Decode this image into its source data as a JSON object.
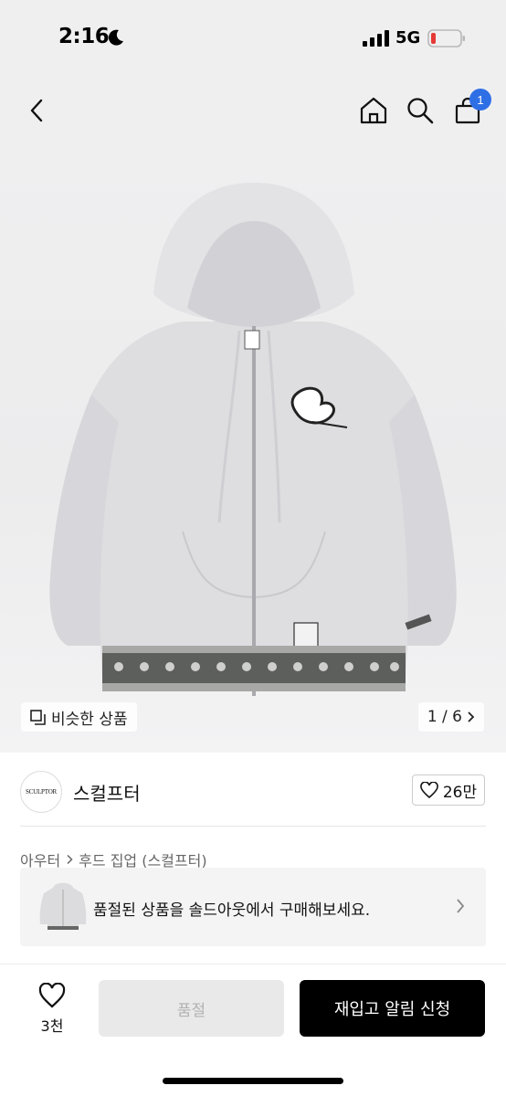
{
  "status_bar": {
    "time": "2:16",
    "network": "5G"
  },
  "nav": {
    "cart_count": "1",
    "icons": [
      "chevron-left-icon",
      "home-icon",
      "search-icon",
      "shopping-bag-icon"
    ]
  },
  "hero": {
    "similar_label": "비슷한 상품",
    "pager": "1 / 6"
  },
  "brand": {
    "logo_text": "SCULPTOR",
    "name": "스컬프터",
    "likes": "26만"
  },
  "breadcrumb": {
    "category": "아우터",
    "subcategory": "후드 집업 (스컬프터)"
  },
  "soldout_banner": {
    "text": "품절된 상품을 솔드아웃에서 구매해보세요."
  },
  "bottom_bar": {
    "wish_count": "3천",
    "soldout_label": "품절",
    "restock_label": "재입고 알림 신청"
  },
  "colors": {
    "badge": "#2f6fe6",
    "primary_button": "#000000",
    "disabled_button": "#e9e9ea"
  }
}
